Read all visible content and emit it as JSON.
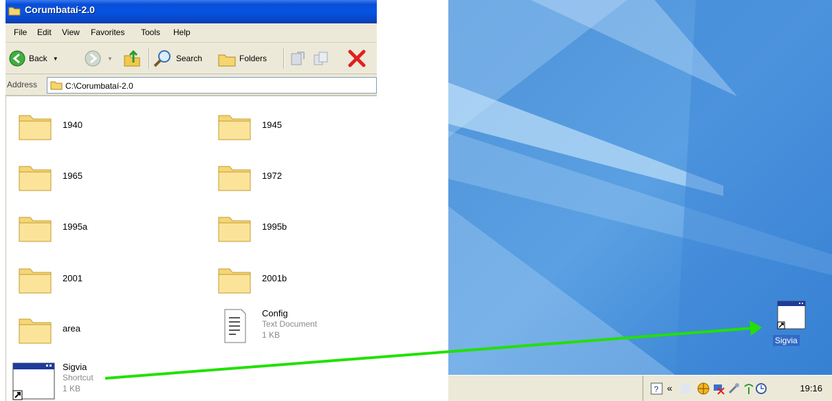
{
  "window": {
    "title": "Corumbataí-2.0",
    "menu": [
      "File",
      "Edit",
      "View",
      "Favorites",
      "Tools",
      "Help"
    ],
    "toolbar": {
      "back_label": "Back",
      "search_label": "Search",
      "folders_label": "Folders"
    },
    "address": {
      "label": "Address",
      "value": "C:\\Corumbataí-2.0"
    }
  },
  "items": [
    {
      "name": "1940",
      "type": "folder"
    },
    {
      "name": "1945",
      "type": "folder"
    },
    {
      "name": "1965",
      "type": "folder"
    },
    {
      "name": "1972",
      "type": "folder"
    },
    {
      "name": "1995a",
      "type": "folder"
    },
    {
      "name": "1995b",
      "type": "folder"
    },
    {
      "name": "2001",
      "type": "folder"
    },
    {
      "name": "2001b",
      "type": "folder"
    },
    {
      "name": "area",
      "type": "folder"
    },
    {
      "name": "Config",
      "type": "text",
      "kind": "Text Document",
      "size": "1 KB"
    },
    {
      "name": "Sigvia",
      "type": "shortcut",
      "kind": "Shortcut",
      "size": "1 KB"
    }
  ],
  "desktop": {
    "icon_label": "Sigvia",
    "tray": {
      "clock": "19:16",
      "chevron": "«"
    }
  },
  "colors": {
    "arrow": "#22e000",
    "title_bar": "#0554e3",
    "selection": "#316ac5"
  }
}
